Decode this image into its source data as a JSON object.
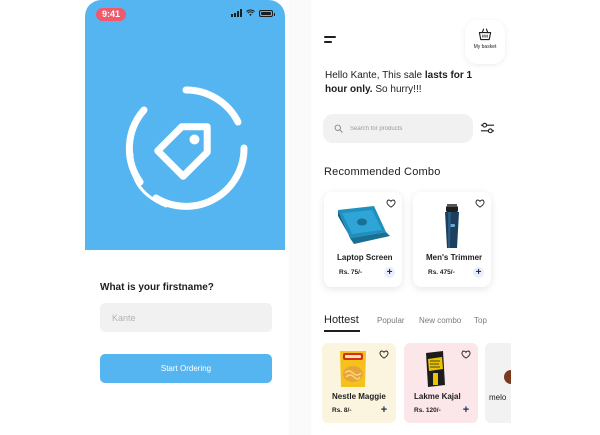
{
  "left": {
    "status": {
      "time": "9:41"
    },
    "question": "What is your firstname?",
    "name_input": {
      "value": "",
      "placeholder": "Kante"
    },
    "start_button": "Start Ordering",
    "colors": {
      "hero": "#55b5f1",
      "time_badge": "#f05a6a"
    }
  },
  "right": {
    "basket_label": "My basket",
    "greeting": {
      "part1": "Hello Kante, This sale ",
      "bold": "lasts for 1 hour only.",
      "part2": " So hurry!!!"
    },
    "search": {
      "value": "",
      "placeholder": "Search for products"
    },
    "recommended_title": "Recommended Combo",
    "combos": [
      {
        "name": "Laptop Screen",
        "price": "Rs. 75/-",
        "icon": "laptop-image"
      },
      {
        "name": "Men's Trimmer",
        "price": "Rs. 475/-",
        "icon": "trimmer-image"
      }
    ],
    "tabs": [
      {
        "label": "Hottest",
        "active": true
      },
      {
        "label": "Popular",
        "active": false
      },
      {
        "label": "New combo",
        "active": false
      },
      {
        "label": "Top",
        "active": false
      }
    ],
    "hottest": [
      {
        "name": "Nestle Maggie",
        "price": "Rs. 8/-",
        "icon": "maggie-image",
        "bg": "#fbf5df"
      },
      {
        "name": "Lakme Kajal",
        "price": "Rs. 120/-",
        "icon": "kajal-image",
        "bg": "#fbe6ea"
      },
      {
        "name": "melo",
        "price": "",
        "icon": "product-image",
        "bg": "#f2f2f2"
      }
    ]
  }
}
